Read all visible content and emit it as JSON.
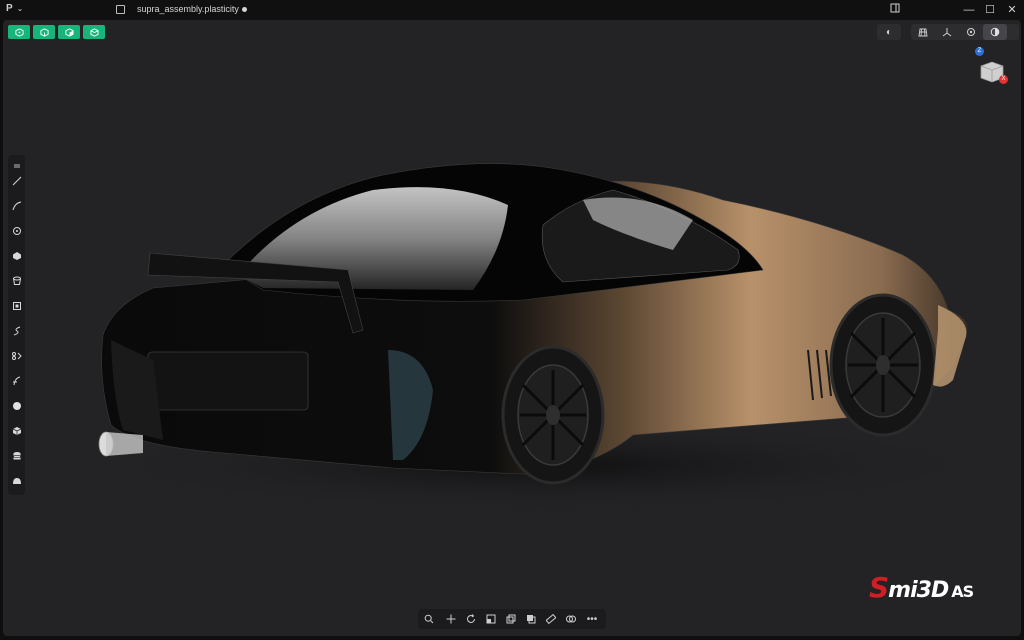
{
  "app": {
    "menu_label": "P",
    "menu_caret": "⌄"
  },
  "file": {
    "title": "supra_assembly.plasticity"
  },
  "window_controls": {
    "minimize": "—",
    "maximize": "☐",
    "close": "✕"
  },
  "selection_modes": [
    "vertex-select",
    "edge-select",
    "face-select",
    "solid-select"
  ],
  "view_controls": {
    "xray": "◐",
    "items": [
      "grid-icon",
      "axes-icon",
      "settings-icon",
      "render-mode-icon"
    ]
  },
  "nav_cube": {
    "badge_top": "Z",
    "badge_x": "X"
  },
  "left_tools": [
    "grip-icon",
    "line-icon",
    "curve-icon",
    "circle-icon",
    "polygon-icon",
    "cylinder-icon",
    "box-icon",
    "spline-icon",
    "mirror-icon",
    "fillet-icon",
    "sphere-icon",
    "cube-icon",
    "stack-icon",
    "shape-icon"
  ],
  "bottom_tools": [
    "search-icon",
    "move-icon",
    "rotate-icon",
    "scale-icon",
    "duplicate-icon",
    "boolean-icon",
    "measure-icon",
    "fillet-icon",
    "more-icon"
  ],
  "more_label": "•••",
  "watermark": {
    "s": "S",
    "main": "mi3D",
    "suffix": "AS"
  }
}
